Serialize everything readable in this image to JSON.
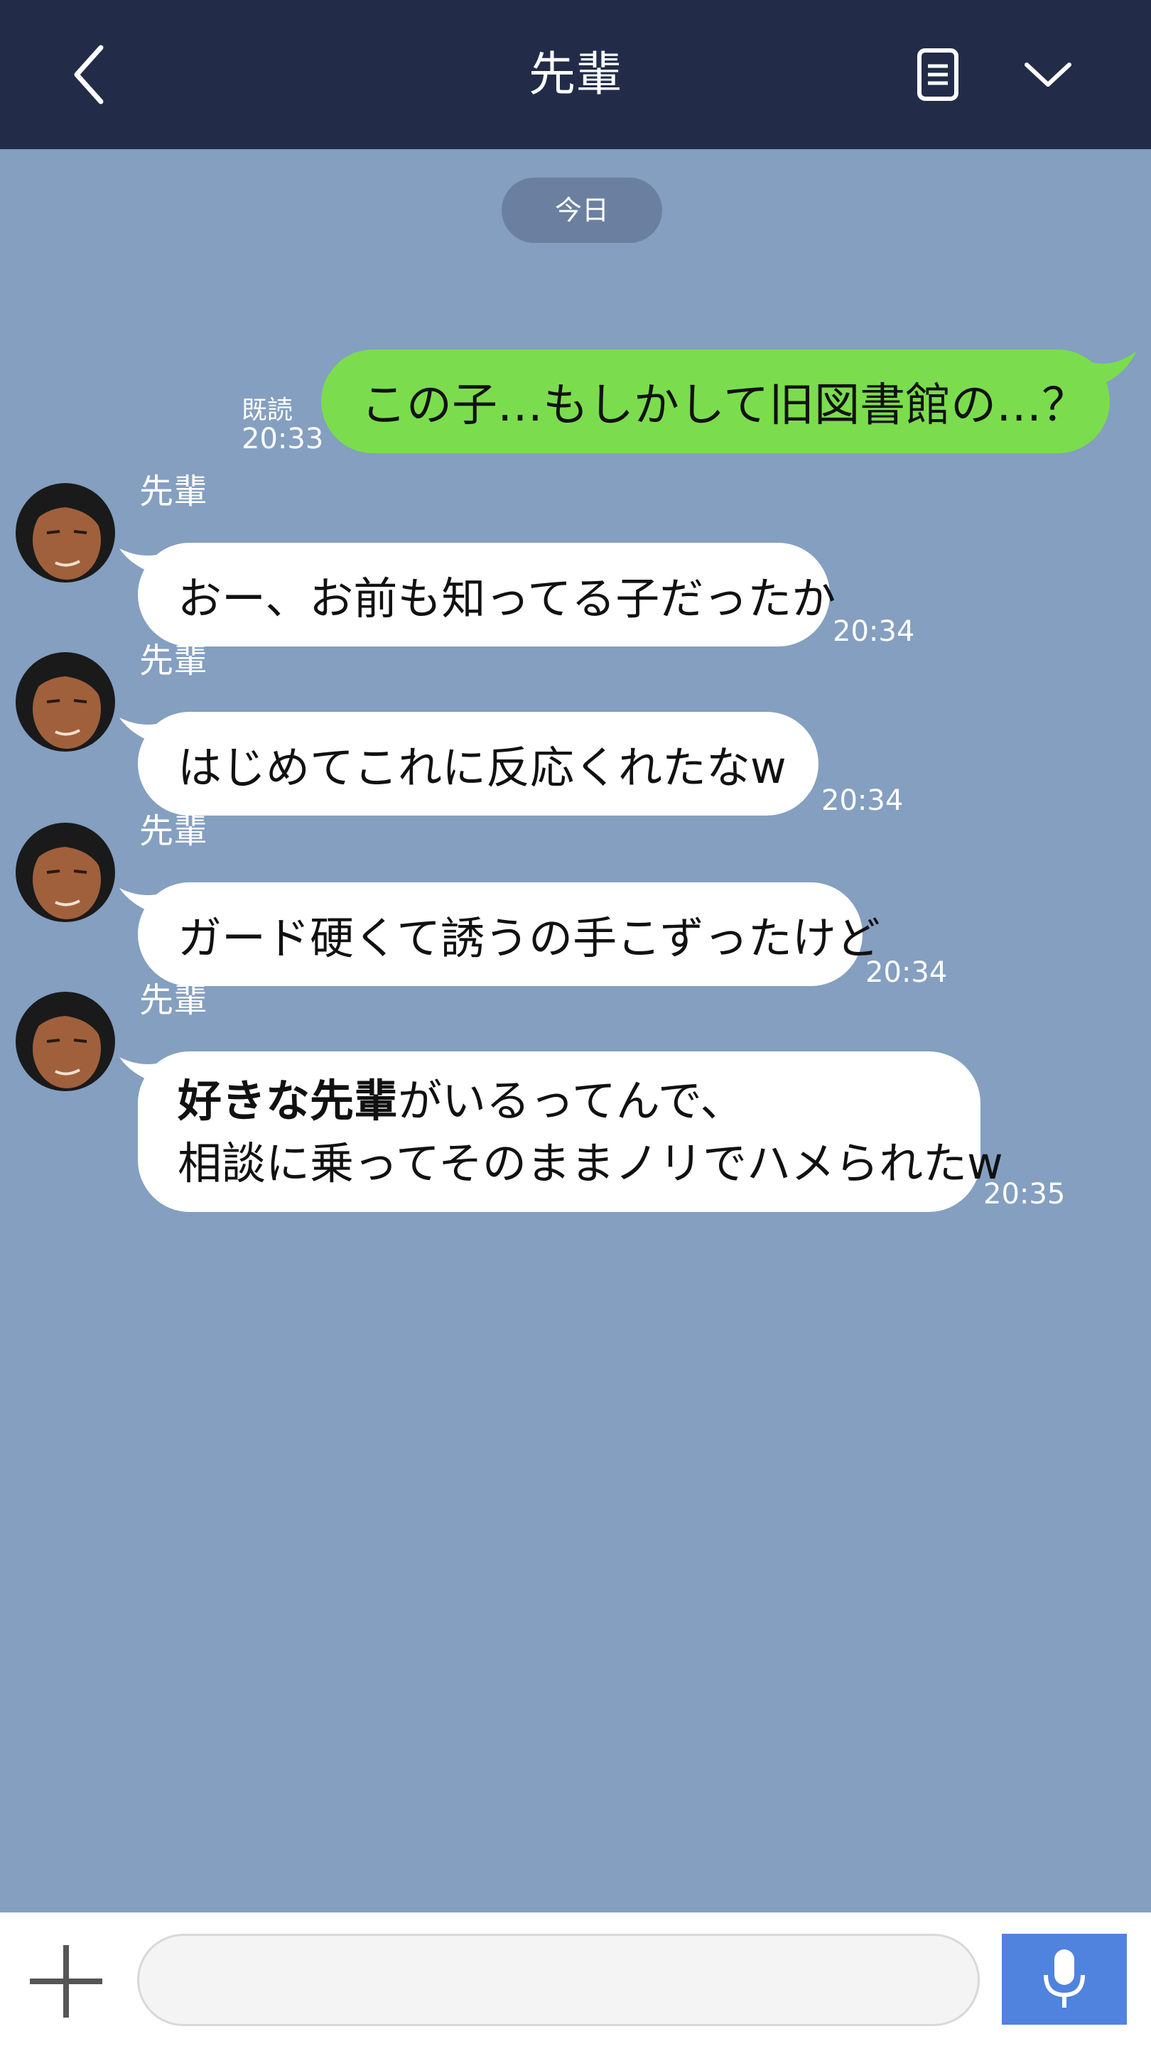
{
  "header": {
    "title": "先輩"
  },
  "date_label": "今日",
  "outgoing": {
    "text": "この子…もしかして旧図書館の…？",
    "read": "既読",
    "time": "20:33"
  },
  "incoming": [
    {
      "sender": "先輩",
      "text": "おー、お前も知ってる子だったか",
      "time": "20:34"
    },
    {
      "sender": "先輩",
      "text": "はじめてこれに反応くれたなw",
      "time": "20:34"
    },
    {
      "sender": "先輩",
      "text": "ガード硬くて誘うの手こずったけど",
      "time": "20:34"
    },
    {
      "sender": "先輩",
      "text_bold": "好きな先輩",
      "text_rest": "がいるってんで、",
      "text_line2": "相談に乗ってそのままノリでハメられたw",
      "time": "20:35"
    }
  ],
  "colors": {
    "header": "#222c48",
    "chat_bg": "#849fc0",
    "outgoing_bubble": "#7bdd4d",
    "mic_button": "#4f83dd"
  },
  "icons": [
    "back-arrow-icon",
    "notes-icon",
    "chevron-down-icon",
    "plus-icon",
    "smiley-icon",
    "microphone-icon"
  ]
}
